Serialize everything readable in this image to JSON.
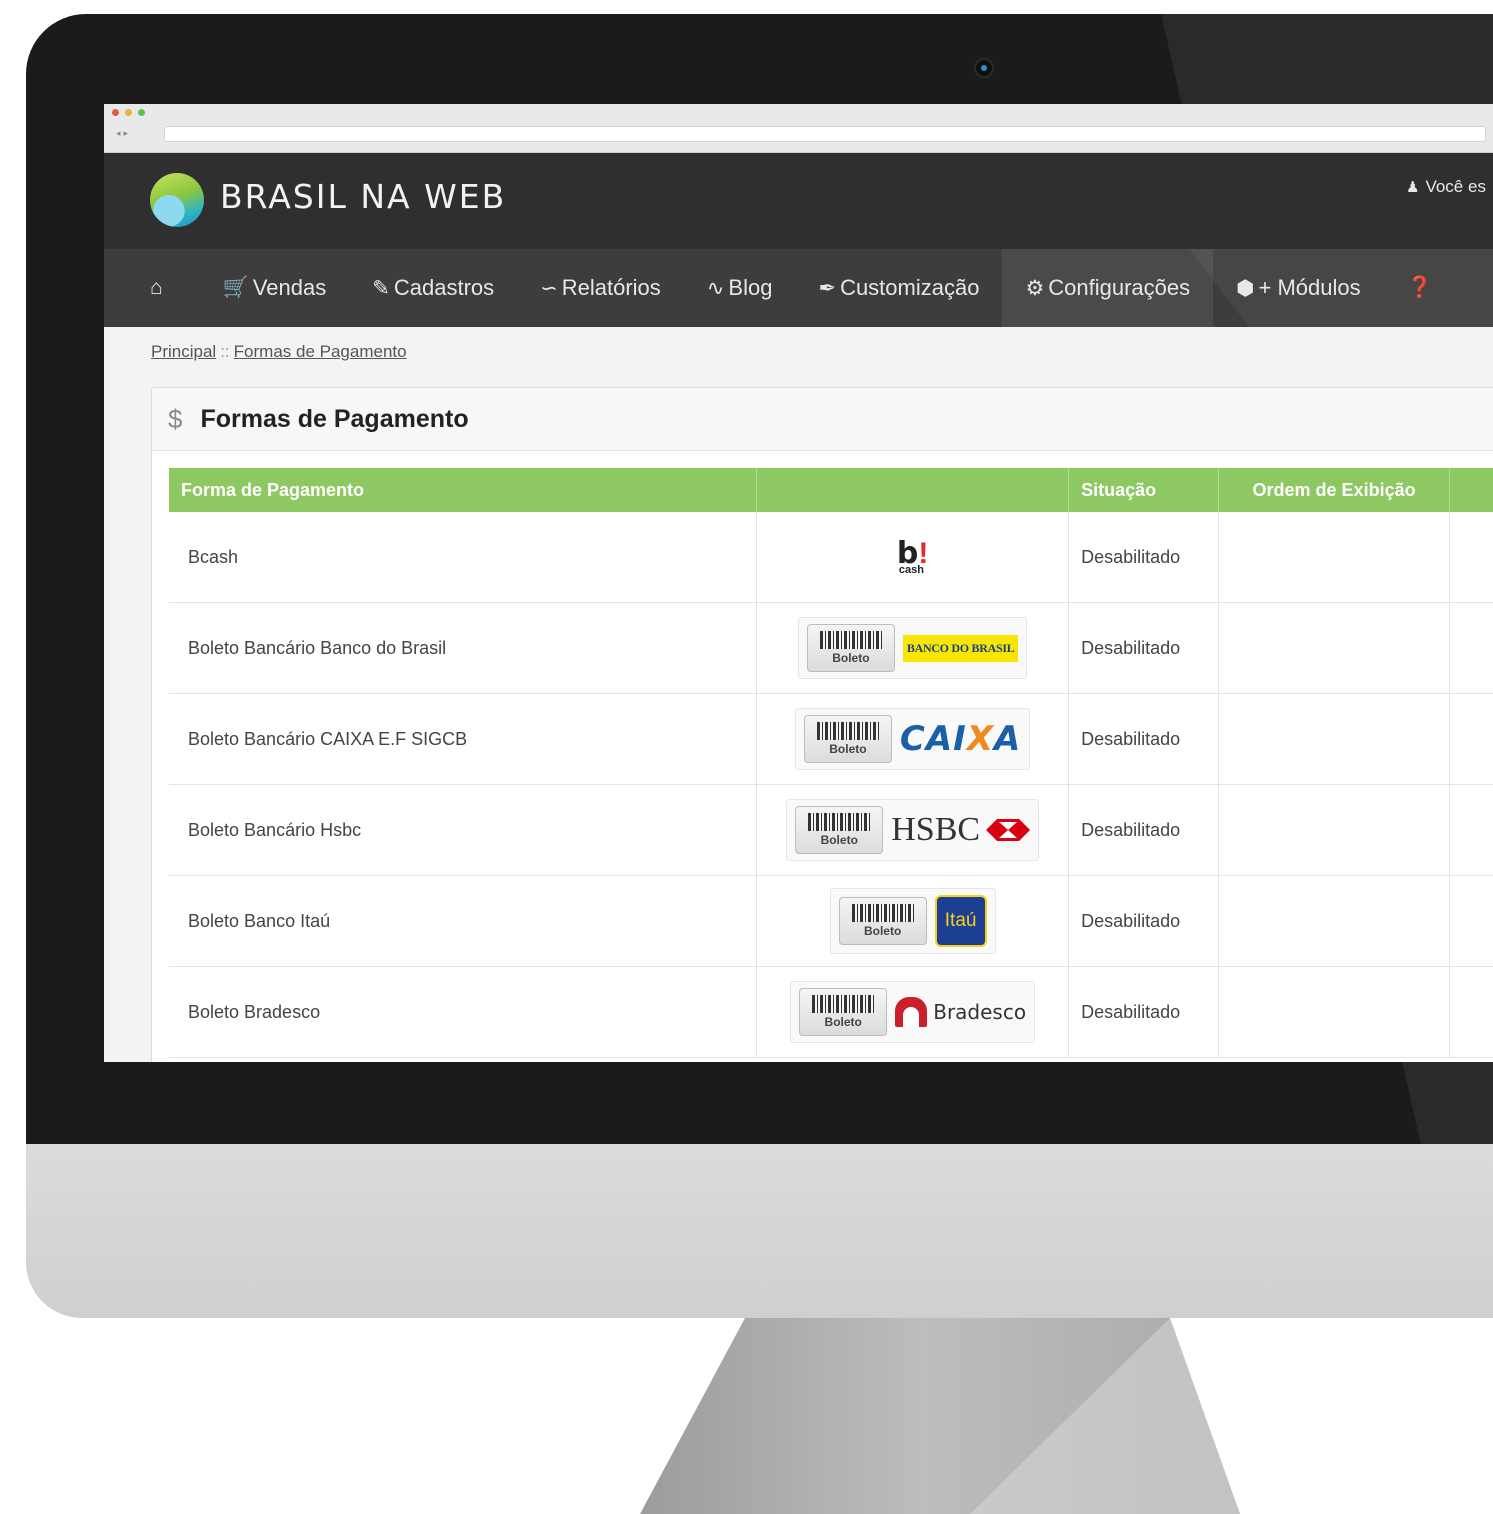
{
  "header": {
    "brand": "BRASIL NA WEB",
    "user_text": "Você es"
  },
  "nav": {
    "items": [
      {
        "icon": "home-icon",
        "label": ""
      },
      {
        "icon": "cart-icon",
        "label": "Vendas"
      },
      {
        "icon": "edit-icon",
        "label": "Cadastros"
      },
      {
        "icon": "chart-icon",
        "label": "Relatórios"
      },
      {
        "icon": "rss-icon",
        "label": "Blog"
      },
      {
        "icon": "brush-icon",
        "label": "Customização"
      },
      {
        "icon": "gear-icon",
        "label": "Configurações"
      },
      {
        "icon": "cube-icon",
        "label": "+ Módulos"
      },
      {
        "icon": "help-icon",
        "label": ""
      }
    ],
    "active_index": 6
  },
  "breadcrumb": {
    "home": "Principal",
    "separator": "::",
    "current": "Formas de Pagamento"
  },
  "panel": {
    "title": "Formas de Pagamento"
  },
  "table": {
    "headers": [
      "Forma de Pagamento",
      "",
      "Situação",
      "Ordem de Exibição",
      ""
    ],
    "rows": [
      {
        "name": "Bcash",
        "logo": "bcash",
        "status": "Desabilitado",
        "order": ""
      },
      {
        "name": "Boleto Bancário Banco do Brasil",
        "logo": "banco-do-brasil",
        "status": "Desabilitado",
        "order": ""
      },
      {
        "name": "Boleto Bancário CAIXA E.F SIGCB",
        "logo": "caixa",
        "status": "Desabilitado",
        "order": ""
      },
      {
        "name": "Boleto Bancário Hsbc",
        "logo": "hsbc",
        "status": "Desabilitado",
        "order": ""
      },
      {
        "name": "Boleto Banco Itaú",
        "logo": "itau",
        "status": "Desabilitado",
        "order": ""
      },
      {
        "name": "Boleto Bradesco",
        "logo": "bradesco",
        "status": "Desabilitado",
        "order": ""
      }
    ]
  },
  "logos": {
    "boleto_label": "Boleto",
    "bcash_mark": "b",
    "bcash_bang": "!",
    "bcash_sub": "cash",
    "bb_text": "BANCO DO BRASIL",
    "caixa_pre": "CAI",
    "caixa_x": "X",
    "caixa_post": "A",
    "hsbc_text": "HSBC",
    "itau_text": "Itaú",
    "bradesco_text": "Bradesco"
  },
  "colors": {
    "header_bg": "#2f2f2f",
    "nav_bg": "#3d3d3d",
    "table_header_green": "#8dc862"
  }
}
